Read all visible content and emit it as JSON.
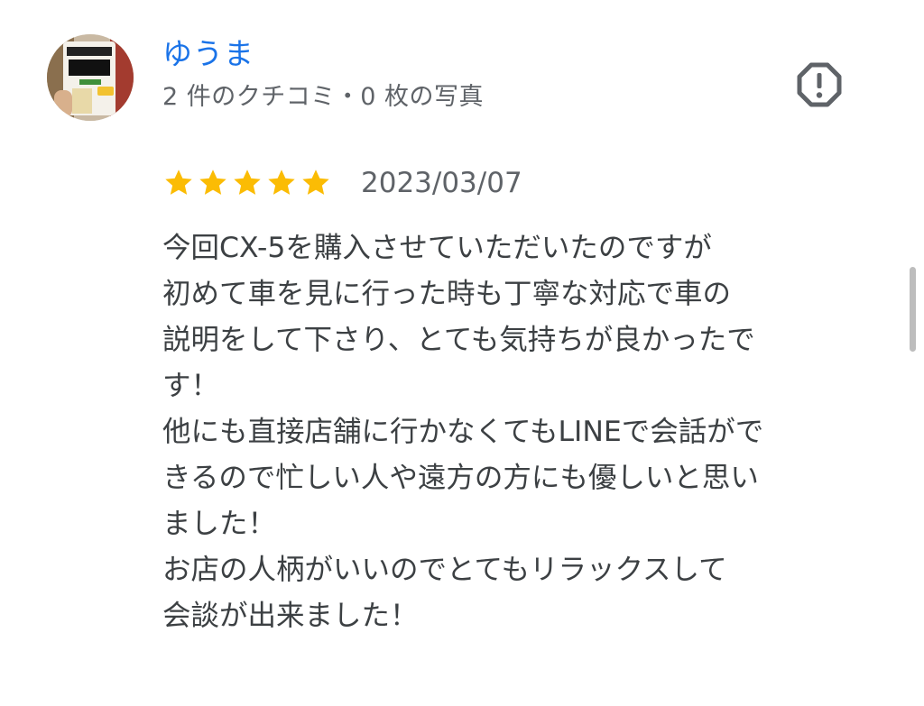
{
  "reviewer": {
    "name": "ゆうま",
    "meta": "2 件のクチコミ・0 枚の写真",
    "avatar_icon": "avatar-photo-snack-cup"
  },
  "review": {
    "rating": 5,
    "max_rating": 5,
    "date": "2023/03/07",
    "lines": [
      "今回CX-5を購入させていただいたのですが",
      "初めて車を見に行った時も丁寧な対応で車の",
      "説明をして下さり、とても気持ちが良かったで",
      "す！",
      "他にも直接店舗に行かなくてもLINEで会話がで",
      "きるので忙しい人や遠方の方にも優しいと思い",
      "ました！",
      "お店の人柄がいいのでとてもリラックスして",
      "会談が出来ました！"
    ]
  },
  "icons": {
    "report": "report-flag-octagon-icon",
    "star": "star-icon"
  },
  "colors": {
    "name_link": "#1a73e8",
    "star": "#fbbc04",
    "secondary_text": "#5f6368",
    "body_text": "#3c4043",
    "report_icon": "#5f6368",
    "scrollbar": "#bdbdbd"
  }
}
